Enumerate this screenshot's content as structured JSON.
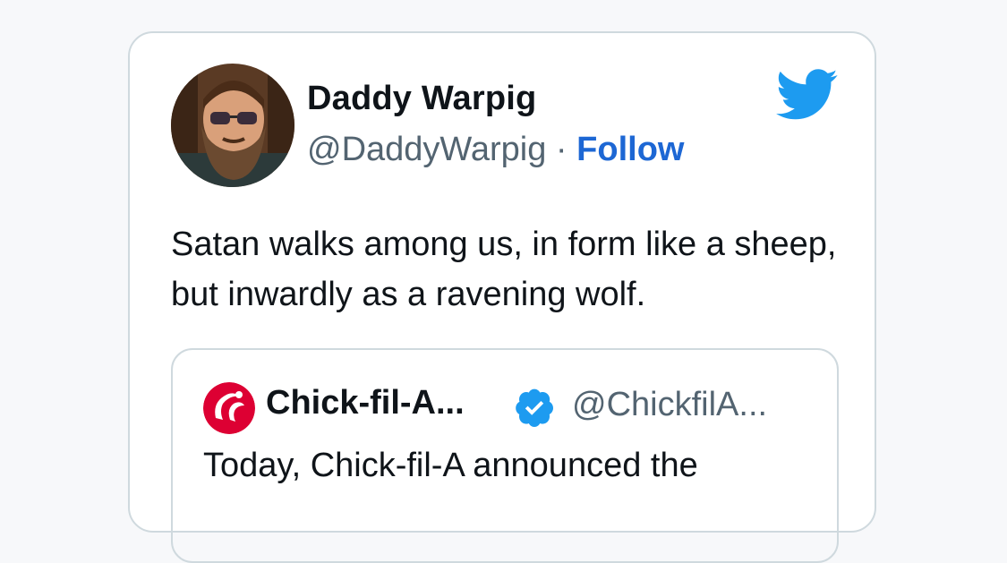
{
  "tweet": {
    "author": {
      "name": "Daddy Warpig",
      "handle": "@DaddyWarpig",
      "separator": " · ",
      "follow_label": "Follow"
    },
    "text": "Satan walks among us, in form like a sheep, but inwardly as a ravening wolf.",
    "brand_icon": "twitter-bird-icon",
    "quoted": {
      "name": "Chick-fil-A...",
      "handle": "@ChickfilA...",
      "verified_icon": "verified-badge-icon",
      "text": "Today, Chick-fil-A announced the"
    }
  },
  "colors": {
    "twitter_blue": "#1d9bf0",
    "follow_blue": "#1d67d4",
    "secondary_text": "#536471",
    "border": "#cfd9de",
    "chickfila_red": "#dd0033"
  }
}
